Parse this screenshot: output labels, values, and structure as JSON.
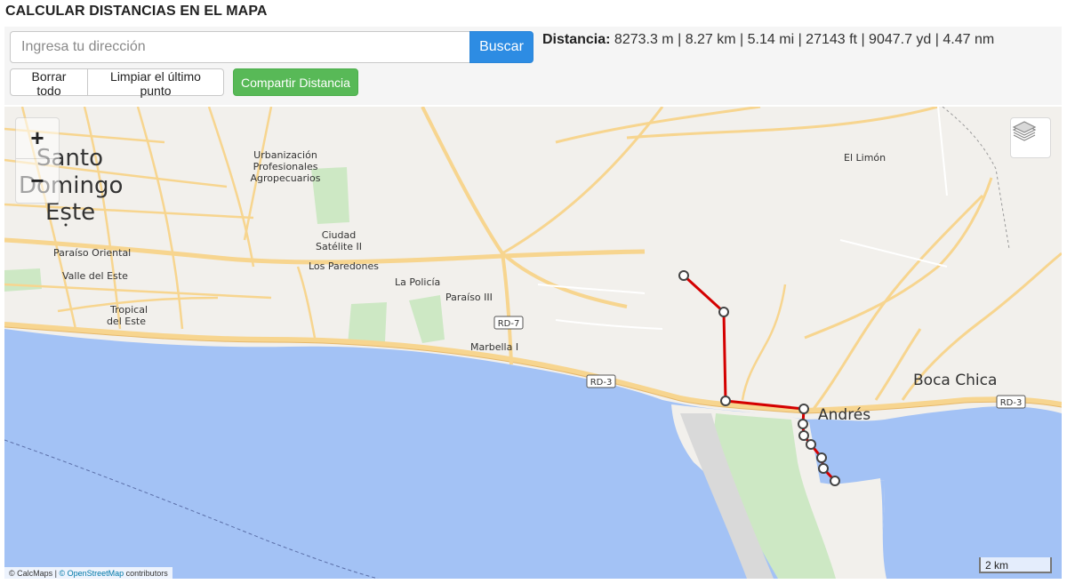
{
  "page": {
    "title": "CALCULAR DISTANCIAS EN EL MAPA"
  },
  "search": {
    "placeholder": "Ingresa tu dirección",
    "value": "",
    "button_label": "Buscar"
  },
  "distance": {
    "label": "Distancia:",
    "meters": "8273.3 m",
    "kilometers": "8.27 km",
    "miles": "5.14 mi",
    "feet": "27143 ft",
    "yards": "9047.7 yd",
    "nautical_miles": "4.47 nm",
    "separator": " | "
  },
  "actions": {
    "clear_all": "Borrar todo",
    "undo_last": "Limpiar el último punto",
    "share": "Compartir Distancia"
  },
  "map": {
    "zoom_in": "+",
    "zoom_out": "−",
    "layers_icon": "layers-icon",
    "labels": {
      "santo": "Santo",
      "domingo": "Domingo",
      "este": "Este",
      "urbanizacion": "Urbanización",
      "profesionales": "Profesionales",
      "agropecuarios": "Agropecuarios",
      "ciudad": "Ciudad",
      "satelite": "Satélite II",
      "paredones": "Los Paredones",
      "policia": "La Policía",
      "paraiso3": "Paraíso III",
      "paraiso_oriental": "Paraíso Oriental",
      "valle": "Valle del Este",
      "tropical1": "Tropical",
      "tropical2": "del Este",
      "marbella": "Marbella I",
      "el_limon": "El Limón",
      "boca_chica": "Boca Chica",
      "andres": "Andrés",
      "rd7": "RD-7",
      "rd3_a": "RD-3",
      "rd3_b": "RD-3"
    },
    "attribution": {
      "calcmaps": "© CalcMaps",
      "sep": " | ",
      "osm": "© OpenStreetMap",
      "contributors": " contributors"
    },
    "scale": "2 km",
    "colors": {
      "water": "#a3c2f5",
      "land": "#f2f0ec",
      "road": "#f7d58f",
      "route": "#d40000",
      "park": "#cde8c4"
    }
  }
}
